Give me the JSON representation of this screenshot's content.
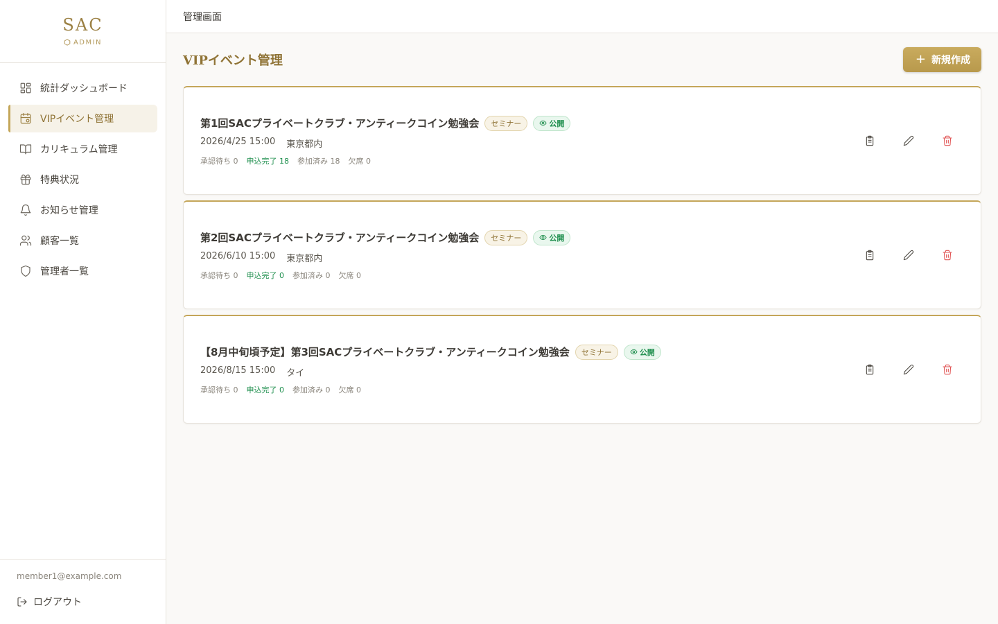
{
  "brand": {
    "title": "SAC",
    "subtitle": "ADMIN"
  },
  "header": {
    "title": "管理画面"
  },
  "sidebar": {
    "items": [
      {
        "label": "統計ダッシュボード",
        "icon": "dashboard-icon"
      },
      {
        "label": "VIPイベント管理",
        "icon": "calendar-icon",
        "active": true
      },
      {
        "label": "カリキュラム管理",
        "icon": "book-icon"
      },
      {
        "label": "特典状況",
        "icon": "gift-icon"
      },
      {
        "label": "お知らせ管理",
        "icon": "bell-icon"
      },
      {
        "label": "顧客一覧",
        "icon": "users-icon"
      },
      {
        "label": "管理者一覧",
        "icon": "shield-icon"
      }
    ],
    "user_email": "member1@example.com",
    "logout_label": "ログアウト"
  },
  "main": {
    "title": "VIPイベント管理",
    "new_button": "新規作成",
    "events": [
      {
        "title": "第1回SACプライベートクラブ・アンティークコイン勉強会",
        "category": "セミナー",
        "status": "公開",
        "datetime": "2026/4/25 15:00",
        "location": "東京都内",
        "stats": {
          "pending": "承認待ち 0",
          "applied": "申込完了 18",
          "attended": "参加済み 18",
          "absent": "欠席 0"
        }
      },
      {
        "title": "第2回SACプライベートクラブ・アンティークコイン勉強会",
        "category": "セミナー",
        "status": "公開",
        "datetime": "2026/6/10 15:00",
        "location": "東京都内",
        "stats": {
          "pending": "承認待ち 0",
          "applied": "申込完了 0",
          "attended": "参加済み 0",
          "absent": "欠席 0"
        }
      },
      {
        "title": "【8月中旬頃予定】第3回SACプライベートクラブ・アンティークコイン勉強会",
        "category": "セミナー",
        "status": "公開",
        "datetime": "2026/8/15 15:00",
        "location": "タイ",
        "stats": {
          "pending": "承認待ち 0",
          "applied": "申込完了 0",
          "attended": "参加済み 0",
          "absent": "欠席 0"
        }
      }
    ]
  },
  "colors": {
    "accent": "#c4a659",
    "accent_text": "#8f7335",
    "success": "#1f8f4e",
    "danger": "#e05252"
  }
}
